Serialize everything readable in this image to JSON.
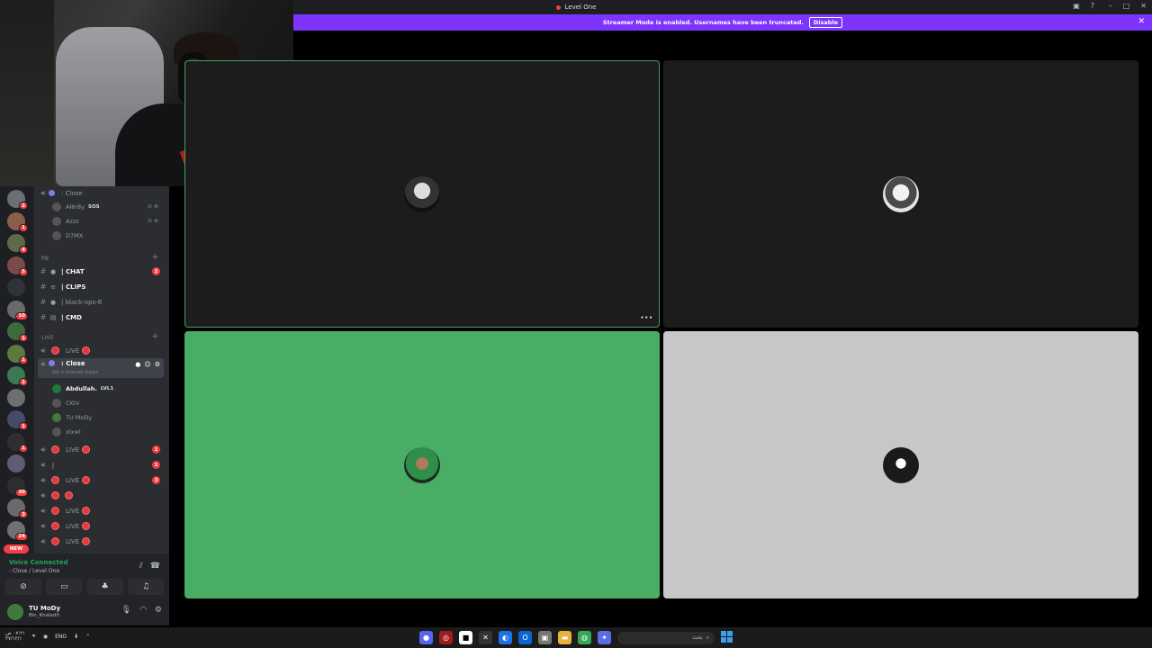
{
  "window": {
    "title": "Level One"
  },
  "streamer": {
    "message": "Streamer Mode is enabled. Usernames have been truncated.",
    "disable_label": "Disable"
  },
  "channels": {
    "top_voice": {
      "name": ": Close",
      "members": [
        {
          "name": "Al6r8y",
          "tag": "SOS"
        },
        {
          "name": "Azzz",
          "tag": ""
        },
        {
          "name": "D7MX",
          "tag": ""
        }
      ]
    },
    "category_pb": "PB",
    "text_channels": [
      {
        "name": "| CHAT",
        "badge": "2",
        "bold": true
      },
      {
        "name": "| CLIPS",
        "badge": "",
        "bold": true
      },
      {
        "name": "| black-ops-6",
        "badge": "",
        "bold": false
      },
      {
        "name": "| CMD",
        "badge": "",
        "bold": true
      }
    ],
    "category_live": "LIVE",
    "live_1": "LIVE",
    "active_voice": {
      "name": ": Close",
      "status_hint": "Set a channel status",
      "members": [
        {
          "name": "Abdullah.",
          "tag": "LVL1"
        },
        {
          "name": "CKIV",
          "tag": ""
        },
        {
          "name": "TU MoDy",
          "tag": ""
        },
        {
          "name": "xlxwl",
          "tag": ""
        }
      ]
    },
    "after": [
      {
        "name": "LIVE",
        "badge": "1"
      },
      {
        "name": "J",
        "badge": "1"
      },
      {
        "name": "LIVE",
        "badge": "3"
      },
      {
        "name": "",
        "badge": ""
      },
      {
        "name": "LIVE",
        "badge": ""
      },
      {
        "name": "LIVE",
        "badge": ""
      },
      {
        "name": "LIVE",
        "badge": ""
      }
    ]
  },
  "rail": {
    "badges": [
      "2",
      "1",
      "4",
      "5",
      "",
      "10",
      "1",
      "1",
      "1",
      "",
      "1",
      "1",
      "",
      "30",
      "3",
      "24"
    ],
    "new_label": "NEW"
  },
  "voice": {
    "status": "Voice Connected",
    "channel": ": Close / Level One"
  },
  "user": {
    "name": "TU MoDy",
    "status": "Bin_Khaled0"
  },
  "taskbar": {
    "lang": "ENG",
    "time": "٠٧:٢١ ص",
    "date": "٢٧/١٢/١",
    "search_placeholder": "بحث"
  },
  "colors": {
    "accent": "#7d34ff",
    "speaking": "#3ba55d",
    "danger": "#f23f43"
  }
}
